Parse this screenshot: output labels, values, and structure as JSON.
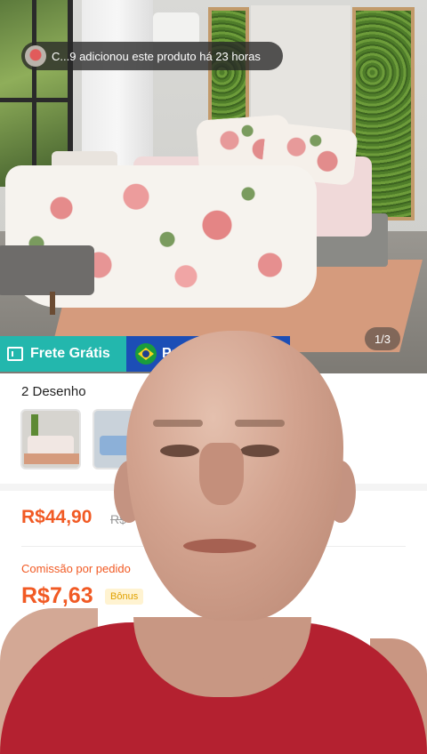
{
  "notification": {
    "text": "C...9 adicionou este produto há 23 horas"
  },
  "gallery": {
    "counter": "1/3"
  },
  "badges": {
    "free_shipping": "Frete Grátis",
    "brazil_partial": "Pr"
  },
  "product": {
    "design_title": "2 Desenho",
    "price": "R$44,90",
    "old_price_partial": "R$",
    "commission_label": "Comissão por pedido",
    "commission_value": "R$7,63",
    "bonus_partial": "Bônus",
    "stub_partial": "R$"
  },
  "colors": {
    "accent": "#f15a24",
    "free_shipping_bg": "#23b7ad",
    "brazil_bg": "#1c4eb6"
  }
}
